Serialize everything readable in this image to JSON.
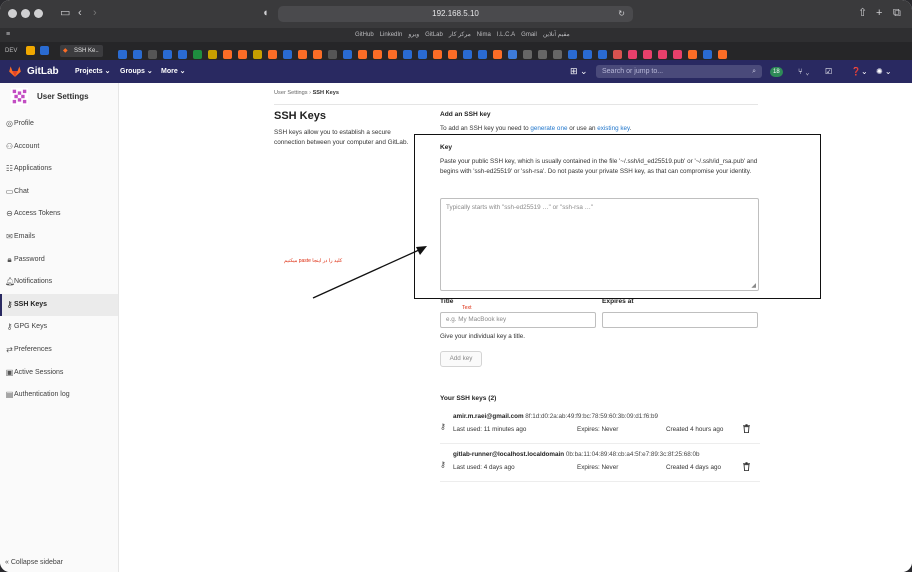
{
  "browser": {
    "address": "192.168.5.10",
    "bookmarks": [
      "GitHub",
      "LinkedIn",
      "ویرو",
      "GitLab",
      "مرکز کار",
      "Nima",
      "I.L.C.A",
      "Gmail",
      "مقیم آنلاین"
    ],
    "tab_title": "SSH Ke.."
  },
  "gitlab": {
    "brand": "GitLab",
    "menu_projects": "Projects ⌄",
    "menu_groups": "Groups ⌄",
    "menu_more": "More ⌄",
    "search_placeholder": "Search or jump to...",
    "mr_count": "18"
  },
  "sidebar": {
    "title": "User Settings",
    "items": [
      {
        "label": "Profile",
        "icon": "user-icon"
      },
      {
        "label": "Account",
        "icon": "account-icon"
      },
      {
        "label": "Applications",
        "icon": "applications-icon"
      },
      {
        "label": "Chat",
        "icon": "chat-icon"
      },
      {
        "label": "Access Tokens",
        "icon": "token-icon"
      },
      {
        "label": "Emails",
        "icon": "mail-icon"
      },
      {
        "label": "Password",
        "icon": "lock-icon"
      },
      {
        "label": "Notifications",
        "icon": "bell-icon"
      },
      {
        "label": "SSH Keys",
        "icon": "key-icon"
      },
      {
        "label": "GPG Keys",
        "icon": "key-icon"
      },
      {
        "label": "Preferences",
        "icon": "preferences-icon"
      },
      {
        "label": "Active Sessions",
        "icon": "monitor-icon"
      },
      {
        "label": "Authentication log",
        "icon": "log-icon"
      }
    ],
    "collapse": "Collapse sidebar"
  },
  "breadcrumb": {
    "parent": "User Settings",
    "current": "SSH Keys"
  },
  "page": {
    "title": "SSH Keys",
    "description": "SSH keys allow you to establish a secure connection between your computer and GitLab.",
    "add_heading": "Add an SSH key",
    "add_text_prefix": "To add an SSH key you need to ",
    "add_link1": "generate one",
    "add_text_mid": " or use an ",
    "add_link2": "existing key",
    "add_text_suffix": ".",
    "key_label": "Key",
    "key_help": "Paste your public SSH key, which is usually contained in the file '~/.ssh/id_ed25519.pub' or '~/.ssh/id_rsa.pub' and begins with 'ssh-ed25519' or 'ssh-rsa'. Do not paste your private SSH key, as that can compromise your identity.",
    "key_placeholder": "Typically starts with \"ssh-ed25519 …\" or \"ssh-rsa …\"",
    "title_label": "Title",
    "title_hint": "Text",
    "title_placeholder": "e.g. My MacBook key",
    "title_help": "Give your individual key a title.",
    "expires_label": "Expires at",
    "add_button": "Add key",
    "annotation": "کلید را در اینجا paste میکنیم"
  },
  "keys": {
    "heading": "Your SSH keys (2)",
    "list": [
      {
        "name": "amir.m.raei@gmail.com",
        "fingerprint": "8f:1d:d0:2a:ab:49:f9:bc:78:59:60:3b:09:d1:f6:b9",
        "last_used": "Last used: 11 minutes ago",
        "expires": "Expires: Never",
        "created": "Created 4 hours ago"
      },
      {
        "name": "gitlab-runner@localhost.localdomain",
        "fingerprint": "0b:ba:11:04:89:48:cb:a4:5f:e7:89:3c:8f:25:68:0b",
        "last_used": "Last used: 4 days ago",
        "expires": "Expires: Never",
        "created": "Created 4 days ago"
      }
    ]
  },
  "colors": {
    "topbar": "#292961",
    "link": "#1f75cb",
    "annotation": "#dd2b0e"
  }
}
